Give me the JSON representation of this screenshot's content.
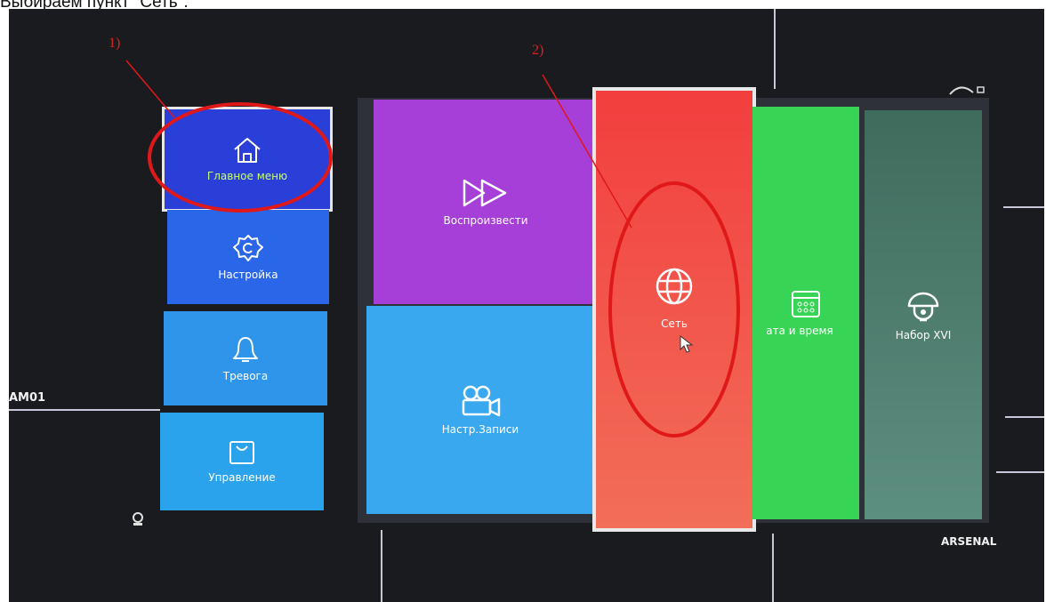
{
  "caption": "Выбираем пункт \"Сеть\".",
  "osd": {
    "camera_label": "AM01",
    "brand": "ARSENAL"
  },
  "sidebar": {
    "items": [
      {
        "label": "Главное меню",
        "icon": "home-icon",
        "selected": true
      },
      {
        "label": "Настройка",
        "icon": "gear-icon"
      },
      {
        "label": "Тревога",
        "icon": "bell-icon"
      },
      {
        "label": "Управление",
        "icon": "bag-icon"
      }
    ]
  },
  "tiles": [
    {
      "label": "Воспроизвести",
      "icon": "fast-forward-icon",
      "color": "#a63ed8"
    },
    {
      "label": "Настр.Записи",
      "icon": "video-camera-icon",
      "color": "#3aa8ee"
    },
    {
      "label": "Сеть",
      "icon": "globe-icon",
      "color": "#f04848",
      "selected": true
    },
    {
      "label": "ата и время",
      "icon": "calendar-icon",
      "color": "#38d455"
    },
    {
      "label": "Набор XVI",
      "icon": "dome-camera-icon",
      "color": "#4a7a6a"
    }
  ],
  "annotations": {
    "step1": "1)",
    "step2": "2)",
    "color": "#e01818"
  },
  "colors": {
    "sidebar_selected": "#2a3fd8",
    "sidebar_blue": "#2a66e8",
    "sidebar_light": "#2f95ea",
    "selected_border": "#e8e8e8"
  }
}
